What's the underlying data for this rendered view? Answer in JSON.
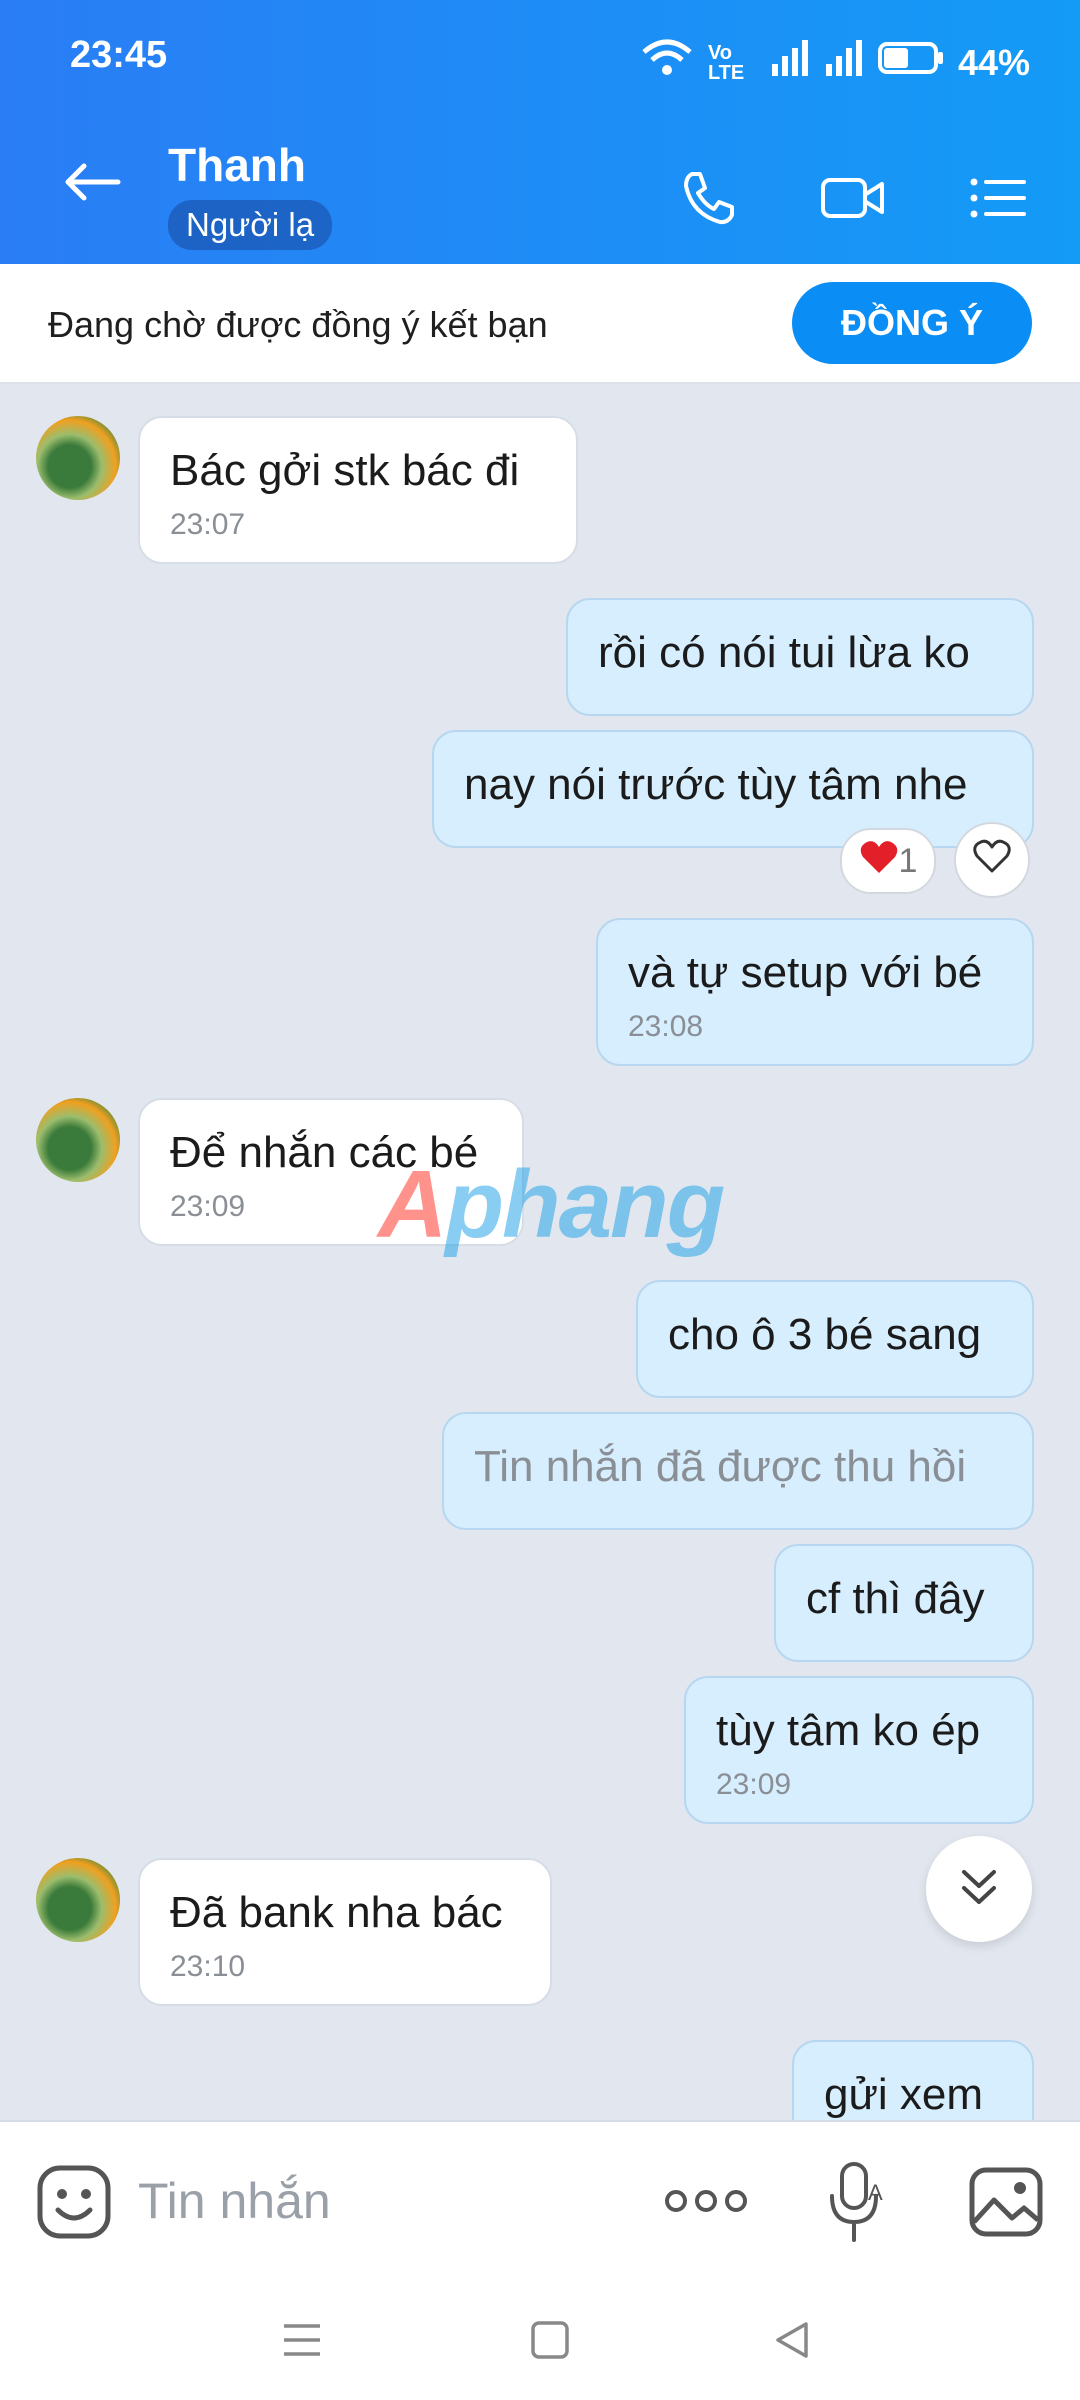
{
  "status": {
    "time": "23:45",
    "network": "Vo LTE",
    "battery": "44%"
  },
  "header": {
    "title": "Thanh",
    "badge": "Người lạ"
  },
  "friend_request": {
    "text": "Đang chờ được đồng ý kết bạn",
    "button": "ĐỒNG Ý"
  },
  "messages": [
    {
      "text": "Bác gởi stk bác đi",
      "time": "23:07"
    },
    {
      "text": "rồi có nói tui lừa ko"
    },
    {
      "text": "nay nói trước tùy tâm nhe",
      "reaction_count": "1"
    },
    {
      "text": "và tự setup với bé",
      "time": "23:08"
    },
    {
      "text": "Để nhắn các bé",
      "time": "23:09"
    },
    {
      "text": "cho ô 3 bé sang"
    },
    {
      "text": "Tin nhắn đã được thu hồi"
    },
    {
      "text": "cf thì đây"
    },
    {
      "text": "tùy tâm ko ép",
      "time": "23:09"
    },
    {
      "text": "Đã bank nha bác",
      "time": "23:10"
    },
    {
      "text": "gửi xem"
    }
  ],
  "input": {
    "placeholder": "Tin nhắn"
  },
  "watermark": {
    "part1": "A",
    "part2": "phang"
  }
}
